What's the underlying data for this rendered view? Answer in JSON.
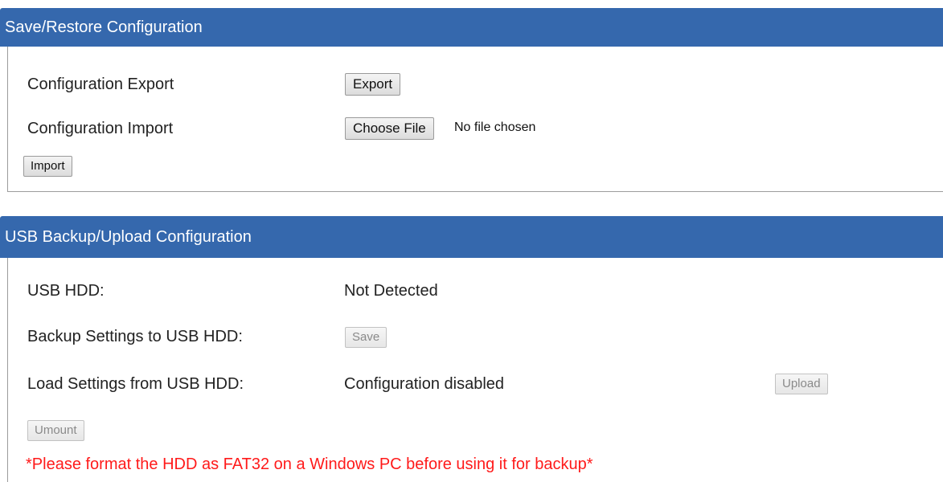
{
  "save_restore": {
    "title": "Save/Restore Configuration",
    "export": {
      "label": "Configuration Export",
      "button": "Export"
    },
    "import": {
      "label": "Configuration Import",
      "choose_button": "Choose File",
      "file_status": "No file chosen",
      "import_button": "Import"
    }
  },
  "usb": {
    "title": "USB Backup/Upload Configuration",
    "hdd": {
      "label": "USB HDD:",
      "value": "Not Detected"
    },
    "backup": {
      "label": "Backup Settings to USB HDD:",
      "button": "Save"
    },
    "load": {
      "label": "Load Settings from USB HDD:",
      "value": "Configuration disabled",
      "button": "Upload"
    },
    "umount_button": "Umount",
    "warning": "*Please format the HDD as FAT32 on a Windows PC before using it for backup*"
  },
  "colors": {
    "header_background": "#3568ad",
    "header_text": "#ffffff",
    "warning_text": "#ff1a1a",
    "disabled_text": "#8a8a8a"
  }
}
